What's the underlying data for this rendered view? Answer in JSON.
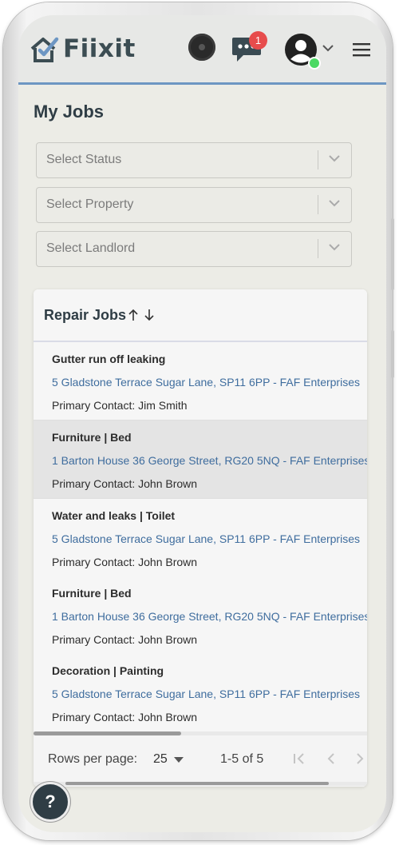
{
  "app": {
    "brand": "Fiixit"
  },
  "header": {
    "notification_count": "1"
  },
  "page": {
    "title": "My Jobs"
  },
  "filters": [
    {
      "placeholder": "Select Status"
    },
    {
      "placeholder": "Select Property"
    },
    {
      "placeholder": "Select Landlord"
    }
  ],
  "table": {
    "title": "Repair Jobs",
    "rows": [
      {
        "title": "Gutter run off leaking",
        "address": "5 Gladstone Terrace Sugar Lane, SP11 6PP - FAF Enterprises",
        "contact": "Primary Contact: Jim Smith"
      },
      {
        "title": "Furniture | Bed",
        "address": "1 Barton House 36 George Street, RG20 5NQ - FAF Enterprises",
        "contact": "Primary Contact: John Brown"
      },
      {
        "title": "Water and leaks | Toilet",
        "address": "5 Gladstone Terrace Sugar Lane, SP11 6PP - FAF Enterprises",
        "contact": "Primary Contact: John Brown"
      },
      {
        "title": "Furniture | Bed",
        "address": "1 Barton House 36 George Street, RG20 5NQ - FAF Enterprises",
        "contact": "Primary Contact: John Brown"
      },
      {
        "title": "Decoration | Painting",
        "address": "5 Gladstone Terrace Sugar Lane, SP11 6PP - FAF Enterprises",
        "contact": "Primary Contact: John Brown"
      }
    ]
  },
  "pagination": {
    "rows_per_page_label": "Rows per page:",
    "rows_per_page_value": "25",
    "range": "1-5 of 5"
  },
  "help": {
    "label": "?"
  },
  "colors": {
    "accent": "#6d96c3",
    "link": "#3f6d9e",
    "badge": "#e74c4c",
    "brand": "#3c4d53"
  }
}
